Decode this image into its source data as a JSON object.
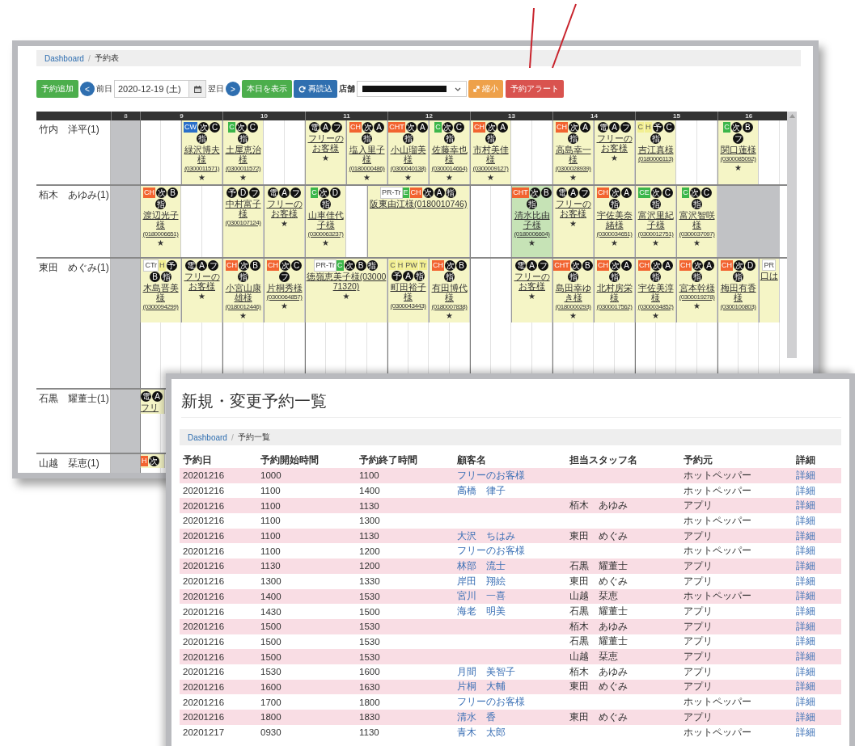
{
  "schedule_window": {
    "breadcrumb": {
      "home": "Dashboard",
      "separator": "/",
      "current": "予約表"
    },
    "toolbar": {
      "add": "予約追加",
      "prev": "<",
      "prev_label": "前日",
      "date": "2020-12-19 (土)",
      "next_label": "翌日",
      "next": ">",
      "today": "本日を表示",
      "reload": "再読込",
      "store_label": "店舗",
      "store_redacted": true,
      "shrink": "縮小",
      "alert": "予約アラート"
    },
    "hours": [
      {
        "label": "8",
        "closed": true
      },
      {
        "label": "9",
        "closed": false
      },
      {
        "label": "10",
        "closed": false
      },
      {
        "label": "11",
        "closed": false
      },
      {
        "label": "12",
        "closed": false
      },
      {
        "label": "13",
        "closed": false
      },
      {
        "label": "14",
        "closed": false
      },
      {
        "label": "15",
        "closed": false
      },
      {
        "label": "16",
        "closed": false
      }
    ],
    "rows": [
      {
        "name": "竹内　洋平(1)",
        "timeline": [
          {
            "kind": "gap"
          },
          {
            "kind": "booking",
            "highlighted": false,
            "tags": [
              {
                "text": "CW",
                "kind": "blue"
              },
              {
                "text": "次",
                "kind": "dot"
              },
              {
                "text": "C",
                "kind": "dot"
              },
              {
                "text": "指",
                "kind": "dot"
              }
            ],
            "customer": "緑沢博夫様",
            "phone": "(0300011571)",
            "mark": "★"
          },
          {
            "kind": "booking",
            "highlighted": false,
            "tags": [
              {
                "text": "C",
                "kind": "green"
              },
              {
                "text": "次",
                "kind": "dot"
              },
              {
                "text": "C",
                "kind": "dot"
              },
              {
                "text": "指",
                "kind": "dot"
              }
            ],
            "customer": "土屋恵治様",
            "phone": "(0300011572)",
            "mark": "★"
          },
          {
            "kind": "gap"
          },
          {
            "kind": "booking",
            "highlighted": false,
            "tags": [
              {
                "text": "電",
                "kind": "dot"
              },
              {
                "text": "A",
                "kind": "dot"
              },
              {
                "text": "フ",
                "kind": "dot"
              }
            ],
            "customer": "フリーのお客様",
            "mark": "★"
          },
          {
            "kind": "booking",
            "highlighted": false,
            "tags": [
              {
                "text": "CH",
                "kind": "orange"
              },
              {
                "text": "次",
                "kind": "dot"
              },
              {
                "text": "A",
                "kind": "dot"
              },
              {
                "text": "指",
                "kind": "dot"
              }
            ],
            "customer": "塩入里子様",
            "phone": "(0180000486)",
            "mark": "★"
          },
          {
            "kind": "booking",
            "highlighted": false,
            "tags": [
              {
                "text": "CHT",
                "kind": "orange"
              },
              {
                "text": "次",
                "kind": "dot"
              },
              {
                "text": "A",
                "kind": "dot"
              },
              {
                "text": "指",
                "kind": "dot"
              }
            ],
            "customer": "小山瑠美様",
            "phone": "(0300040138)",
            "mark": "★"
          },
          {
            "kind": "booking",
            "highlighted": false,
            "tags": [
              {
                "text": "C",
                "kind": "green"
              },
              {
                "text": "次",
                "kind": "dot"
              },
              {
                "text": "C",
                "kind": "dot"
              },
              {
                "text": "指",
                "kind": "dot"
              }
            ],
            "customer": "佐藤幸也様",
            "phone": "(0300014664)",
            "mark": "★"
          },
          {
            "kind": "booking",
            "highlighted": false,
            "tags": [
              {
                "text": "CH",
                "kind": "orange"
              },
              {
                "text": "次",
                "kind": "dot"
              },
              {
                "text": "A",
                "kind": "dot"
              },
              {
                "text": "指",
                "kind": "dot"
              }
            ],
            "customer": "市村美佳様",
            "phone": "(0300009127)",
            "mark": "★"
          },
          {
            "kind": "gap"
          },
          {
            "kind": "booking",
            "highlighted": false,
            "tags": [
              {
                "text": "CH",
                "kind": "orange"
              },
              {
                "text": "次",
                "kind": "dot"
              },
              {
                "text": "A",
                "kind": "dot"
              },
              {
                "text": "指",
                "kind": "dot"
              }
            ],
            "customer": "高島幸一様",
            "phone": "(0300028939)",
            "mark": "★"
          },
          {
            "kind": "booking",
            "highlighted": false,
            "tags": [
              {
                "text": "電",
                "kind": "dot"
              },
              {
                "text": "A",
                "kind": "dot"
              },
              {
                "text": "フ",
                "kind": "dot"
              }
            ],
            "customer": "フリーのお客様",
            "mark": "★"
          },
          {
            "kind": "booking",
            "highlighted": false,
            "tags": [
              {
                "text": "C",
                "kind": "yellow"
              },
              {
                "text": "H",
                "kind": "yellow"
              },
              {
                "text": "予",
                "kind": "dot"
              },
              {
                "text": "C",
                "kind": "dot"
              },
              {
                "text": "指",
                "kind": "dot"
              }
            ],
            "customer": "吉江真様",
            "phone": "(0180006113)"
          },
          {
            "kind": "gap"
          },
          {
            "kind": "booking",
            "highlighted": false,
            "tags": [
              {
                "text": "C",
                "kind": "green"
              },
              {
                "text": "次",
                "kind": "dot"
              },
              {
                "text": "B",
                "kind": "dot"
              },
              {
                "text": "フ",
                "kind": "dot"
              }
            ],
            "customer": "関口蓮様",
            "phone": "(0300085092)",
            "mark": "★"
          }
        ]
      },
      {
        "name": "栢木　あゆみ(1)",
        "timeline": [
          {
            "kind": "booking",
            "highlighted": false,
            "tags": [
              {
                "text": "CH",
                "kind": "orange"
              },
              {
                "text": "次",
                "kind": "dot"
              },
              {
                "text": "B",
                "kind": "dot"
              },
              {
                "text": "指",
                "kind": "dot"
              }
            ],
            "customer": "渡辺光子様",
            "phone": "(0180006651)",
            "mark": "★"
          },
          {
            "kind": "gap"
          },
          {
            "kind": "booking",
            "highlighted": false,
            "tags": [
              {
                "text": "予",
                "kind": "dot"
              },
              {
                "text": "D",
                "kind": "dot"
              },
              {
                "text": "フ",
                "kind": "dot"
              }
            ],
            "customer": "中村富子様",
            "phone": "(0300107124)"
          },
          {
            "kind": "booking",
            "highlighted": false,
            "tags": [
              {
                "text": "電",
                "kind": "dot"
              },
              {
                "text": "A",
                "kind": "dot"
              },
              {
                "text": "フ",
                "kind": "dot"
              }
            ],
            "customer": "フリーのお客様",
            "mark": "★"
          },
          {
            "kind": "booking",
            "highlighted": false,
            "tags": [
              {
                "text": "C",
                "kind": "green"
              },
              {
                "text": "次",
                "kind": "dot"
              },
              {
                "text": "D",
                "kind": "dot"
              },
              {
                "text": "指",
                "kind": "dot"
              }
            ],
            "customer": "山車佳代子様",
            "phone": "(0300063237)",
            "mark": "★"
          },
          {
            "kind": "halfgap"
          },
          {
            "kind": "wider",
            "highlighted": false,
            "tags": [
              {
                "text": "PR-Tr",
                "kind": "white"
              },
              {
                "text": "E",
                "kind": "green"
              },
              {
                "text": "CH",
                "kind": "orange"
              },
              {
                "text": "次",
                "kind": "dot"
              },
              {
                "text": "A",
                "kind": "dot"
              },
              {
                "text": "指",
                "kind": "dot"
              }
            ],
            "customer": "阪東由江様(0180010746)"
          },
          {
            "kind": "gap"
          },
          {
            "kind": "booking",
            "highlighted": true,
            "tags": [
              {
                "text": "CHT",
                "kind": "orange"
              },
              {
                "text": "次",
                "kind": "dot"
              },
              {
                "text": "B",
                "kind": "dot"
              },
              {
                "text": "指",
                "kind": "dot"
              }
            ],
            "customer": "清水比由子様",
            "phone": "(0180006604)",
            "mark": "★"
          },
          {
            "kind": "booking",
            "highlighted": false,
            "tags": [
              {
                "text": "電",
                "kind": "dot"
              },
              {
                "text": "A",
                "kind": "dot"
              },
              {
                "text": "フ",
                "kind": "dot"
              }
            ],
            "customer": "フリーのお客様",
            "mark": "★"
          },
          {
            "kind": "booking",
            "highlighted": false,
            "tags": [
              {
                "text": "CH",
                "kind": "orange"
              },
              {
                "text": "次",
                "kind": "dot"
              },
              {
                "text": "A",
                "kind": "dot"
              },
              {
                "text": "指",
                "kind": "dot"
              }
            ],
            "customer": "宇佐美奈緒様",
            "phone": "(0300034651)",
            "mark": "★"
          },
          {
            "kind": "booking",
            "highlighted": false,
            "tags": [
              {
                "text": "CE",
                "kind": "green"
              },
              {
                "text": "次",
                "kind": "dot"
              },
              {
                "text": "C",
                "kind": "dot"
              },
              {
                "text": "指",
                "kind": "dot"
              }
            ],
            "customer": "富沢里紀子様",
            "phone": "(0300012751)",
            "mark": "★"
          },
          {
            "kind": "booking",
            "highlighted": false,
            "tags": [
              {
                "text": "C",
                "kind": "green"
              },
              {
                "text": "次",
                "kind": "dot"
              },
              {
                "text": "C",
                "kind": "dot"
              },
              {
                "text": "指",
                "kind": "dot"
              }
            ],
            "customer": "富沢智咲様",
            "phone": "(0300037097)",
            "mark": "★"
          },
          {
            "kind": "closed"
          }
        ]
      },
      {
        "name": "東田　めぐみ(1)",
        "timeline": [
          {
            "kind": "booking",
            "highlighted": false,
            "tags": [
              {
                "text": "CTr",
                "kind": "white"
              },
              {
                "text": "H",
                "kind": "yellow"
              },
              {
                "text": "予",
                "kind": "dot"
              },
              {
                "text": "B",
                "kind": "dot"
              },
              {
                "text": "指",
                "kind": "dot"
              }
            ],
            "customer": "木島晋美様",
            "phone": "(0300094299)"
          },
          {
            "kind": "booking",
            "highlighted": false,
            "tags": [
              {
                "text": "電",
                "kind": "dot"
              },
              {
                "text": "A",
                "kind": "dot"
              },
              {
                "text": "フ",
                "kind": "dot"
              }
            ],
            "customer": "フリーのお客様",
            "mark": "★"
          },
          {
            "kind": "booking",
            "highlighted": false,
            "tags": [
              {
                "text": "CH",
                "kind": "orange"
              },
              {
                "text": "次",
                "kind": "dot"
              },
              {
                "text": "B",
                "kind": "dot"
              },
              {
                "text": "指",
                "kind": "dot"
              }
            ],
            "customer": "小宮山康雄様",
            "phone": "(0180012446)",
            "mark": "★"
          },
          {
            "kind": "booking",
            "highlighted": false,
            "tags": [
              {
                "text": "CH",
                "kind": "orange"
              },
              {
                "text": "次",
                "kind": "dot"
              },
              {
                "text": "C",
                "kind": "dot"
              },
              {
                "text": "フ",
                "kind": "dot"
              }
            ],
            "customer": "片桐秀様",
            "phone": "(0300064857)",
            "mark": "★"
          },
          {
            "kind": "wide",
            "highlighted": false,
            "tags": [
              {
                "text": "PR-Tr",
                "kind": "white"
              },
              {
                "text": "C",
                "kind": "green"
              },
              {
                "text": "次",
                "kind": "dot"
              },
              {
                "text": "B",
                "kind": "dot"
              },
              {
                "text": "指",
                "kind": "dot"
              }
            ],
            "customer": "徳嶺恵美子様(0300071320)",
            "mark": "★"
          },
          {
            "kind": "booking",
            "highlighted": false,
            "tags": [
              {
                "text": "C",
                "kind": "yellow"
              },
              {
                "text": "H",
                "kind": "yellow"
              },
              {
                "text": "PW",
                "kind": "yellow"
              },
              {
                "text": "Tr",
                "kind": "yellow"
              },
              {
                "text": "予",
                "kind": "dot"
              },
              {
                "text": "A",
                "kind": "dot"
              },
              {
                "text": "指",
                "kind": "dot"
              }
            ],
            "customer": "町田裕子様",
            "phone": "(0300043443)"
          },
          {
            "kind": "booking",
            "highlighted": false,
            "tags": [
              {
                "text": "CH",
                "kind": "orange"
              },
              {
                "text": "次",
                "kind": "dot"
              },
              {
                "text": "B",
                "kind": "dot"
              },
              {
                "text": "指",
                "kind": "dot"
              }
            ],
            "customer": "有田博代様",
            "phone": "(0180007838)",
            "mark": "★"
          },
          {
            "kind": "gap"
          },
          {
            "kind": "booking",
            "highlighted": false,
            "tags": [
              {
                "text": "電",
                "kind": "dot"
              },
              {
                "text": "A",
                "kind": "dot"
              },
              {
                "text": "フ",
                "kind": "dot"
              }
            ],
            "customer": "フリーのお客様",
            "mark": "★"
          },
          {
            "kind": "booking",
            "highlighted": false,
            "tags": [
              {
                "text": "CHT",
                "kind": "orange"
              },
              {
                "text": "次",
                "kind": "dot"
              },
              {
                "text": "B",
                "kind": "dot"
              },
              {
                "text": "指",
                "kind": "dot"
              }
            ],
            "customer": "島田幸ゆき様",
            "phone": "(0180000293)",
            "mark": "★"
          },
          {
            "kind": "booking",
            "highlighted": false,
            "tags": [
              {
                "text": "CH",
                "kind": "orange"
              },
              {
                "text": "次",
                "kind": "dot"
              },
              {
                "text": "A",
                "kind": "dot"
              },
              {
                "text": "指",
                "kind": "dot"
              }
            ],
            "customer": "北村房栄様",
            "phone": "(0300017562)"
          },
          {
            "kind": "booking",
            "highlighted": false,
            "tags": [
              {
                "text": "CH",
                "kind": "orange"
              },
              {
                "text": "次",
                "kind": "dot"
              },
              {
                "text": "A",
                "kind": "dot"
              },
              {
                "text": "指",
                "kind": "dot"
              }
            ],
            "customer": "宇佐美淳様",
            "phone": "(0300034852)",
            "mark": "★"
          },
          {
            "kind": "booking",
            "highlighted": false,
            "tags": [
              {
                "text": "CH",
                "kind": "orange"
              },
              {
                "text": "次",
                "kind": "dot"
              },
              {
                "text": "A",
                "kind": "dot"
              },
              {
                "text": "指",
                "kind": "dot"
              }
            ],
            "customer": "宮本幹様",
            "phone": "(0300019278)",
            "mark": "★"
          },
          {
            "kind": "booking",
            "highlighted": false,
            "tags": [
              {
                "text": "CH",
                "kind": "orange"
              },
              {
                "text": "次",
                "kind": "dot"
              },
              {
                "text": "D",
                "kind": "dot"
              },
              {
                "text": "指",
                "kind": "dot"
              }
            ],
            "customer": "梅田有香様",
            "phone": "(0300100803)"
          },
          {
            "kind": "booking",
            "highlighted": false,
            "tags": [
              {
                "text": "PR",
                "kind": "white"
              }
            ],
            "customer": "口は"
          }
        ]
      },
      {
        "name": "石黒　耀董士(1)",
        "timeline": [
          {
            "kind": "booking",
            "highlighted": false,
            "tags": [
              {
                "text": "電",
                "kind": "dot"
              },
              {
                "text": "A",
                "kind": "dot"
              }
            ],
            "customer": "フリ"
          }
        ]
      },
      {
        "name": "山越　栞恵(1)",
        "timeline": [
          {
            "kind": "booking",
            "highlighted": false,
            "tags": [
              {
                "text": "H",
                "kind": "orange"
              },
              {
                "text": "次",
                "kind": "dot"
              }
            ]
          }
        ]
      }
    ]
  },
  "list_window": {
    "title": "新規・変更予約一覧",
    "breadcrumb": {
      "home": "Dashboard",
      "separator": "/",
      "current": "予約一覧"
    },
    "columns": [
      "予約日",
      "予約開始時間",
      "予約終了時間",
      "顧客名",
      "担当スタッフ名",
      "予約元",
      "詳細"
    ],
    "rows": [
      [
        "20201216",
        "1000",
        "1100",
        "フリーのお客様",
        "",
        "ホットペッパー",
        "詳細"
      ],
      [
        "20201216",
        "1100",
        "1400",
        "高橋　律子",
        "",
        "ホットペッパー",
        "詳細"
      ],
      [
        "20201216",
        "1100",
        "1130",
        "",
        "栢木　あゆみ",
        "アプリ",
        "詳細"
      ],
      [
        "20201216",
        "1100",
        "1300",
        "",
        "",
        "ホットペッパー",
        "詳細"
      ],
      [
        "20201216",
        "1100",
        "1130",
        "大沢　ちはみ",
        "東田　めぐみ",
        "アプリ",
        "詳細"
      ],
      [
        "20201216",
        "1100",
        "1200",
        "フリーのお客様",
        "",
        "ホットペッパー",
        "詳細"
      ],
      [
        "20201216",
        "1130",
        "1200",
        "林部　流士",
        "石黒　耀董士",
        "アプリ",
        "詳細"
      ],
      [
        "20201216",
        "1300",
        "1330",
        "岸田　翔絵",
        "東田　めぐみ",
        "アプリ",
        "詳細"
      ],
      [
        "20201216",
        "1400",
        "1530",
        "宮川　一喜",
        "山越　栞恵",
        "ホットペッパー",
        "詳細"
      ],
      [
        "20201216",
        "1430",
        "1500",
        "海老　明美",
        "石黒　耀董士",
        "アプリ",
        "詳細"
      ],
      [
        "20201216",
        "1500",
        "1530",
        "",
        "栢木　あゆみ",
        "アプリ",
        "詳細"
      ],
      [
        "20201216",
        "1500",
        "1530",
        "",
        "石黒　耀董士",
        "アプリ",
        "詳細"
      ],
      [
        "20201216",
        "1500",
        "1530",
        "",
        "山越　栞恵",
        "アプリ",
        "詳細"
      ],
      [
        "20201216",
        "1530",
        "1600",
        "月間　美智子",
        "栢木　あゆみ",
        "アプリ",
        "詳細"
      ],
      [
        "20201216",
        "1600",
        "1630",
        "片桐　大輔",
        "東田　めぐみ",
        "アプリ",
        "詳細"
      ],
      [
        "20201216",
        "1700",
        "1800",
        "フリーのお客様",
        "",
        "ホットペッパー",
        "詳細"
      ],
      [
        "20201216",
        "1800",
        "1830",
        "清水　香",
        "東田　めぐみ",
        "アプリ",
        "詳細"
      ],
      [
        "20201217",
        "0930",
        "1130",
        "青木　太郎",
        "",
        "ホットペッパー",
        "詳細"
      ]
    ]
  }
}
